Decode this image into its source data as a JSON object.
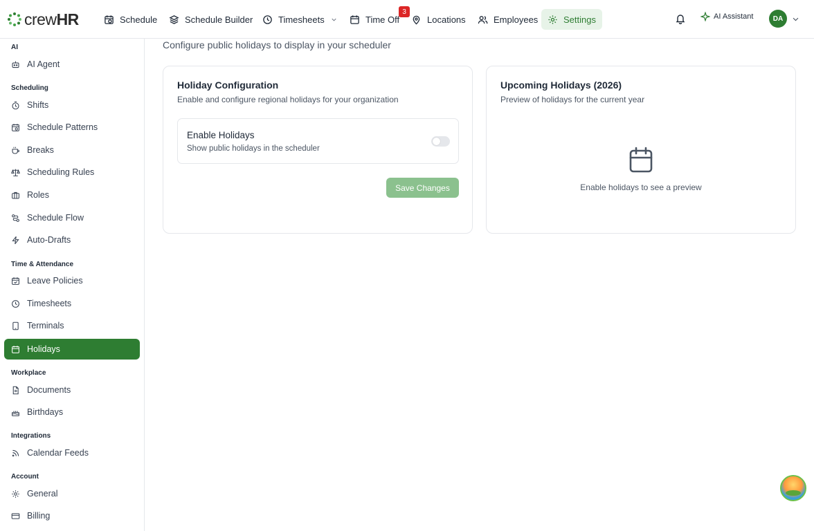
{
  "header": {
    "logo": {
      "prefix": "crew",
      "suffix": "HR"
    },
    "nav": [
      {
        "label": "Schedule",
        "icon": "calendar-clock-icon"
      },
      {
        "label": "Schedule Builder",
        "icon": "layers-icon"
      },
      {
        "label": "Timesheets",
        "icon": "clock-icon"
      },
      {
        "label": "Time Off",
        "icon": "calendar-icon",
        "badge": "3"
      },
      {
        "label": "Locations",
        "icon": "map-pin-icon"
      },
      {
        "label": "Employees",
        "icon": "users-icon"
      },
      {
        "label": "Settings",
        "icon": "gear-icon"
      }
    ],
    "ai_assistant_label": "AI Assistant",
    "avatar_initials": "DA",
    "accent_color": "#2e7d32"
  },
  "sidebar": {
    "sections": [
      {
        "title": "AI",
        "items": [
          "AI Agent"
        ]
      },
      {
        "title": "Scheduling",
        "items": [
          "Shifts",
          "Schedule Patterns",
          "Breaks",
          "Scheduling Rules",
          "Roles",
          "Schedule Flow",
          "Auto-Drafts"
        ]
      },
      {
        "title": "Time & Attendance",
        "items": [
          "Leave Policies",
          "Timesheets",
          "Terminals",
          "Holidays"
        ]
      },
      {
        "title": "Workplace",
        "items": [
          "Documents",
          "Birthdays"
        ]
      },
      {
        "title": "Integrations",
        "items": [
          "Calendar Feeds"
        ]
      },
      {
        "title": "Account",
        "items": [
          "General",
          "Billing"
        ]
      }
    ],
    "active_item": "Holidays"
  },
  "main": {
    "subtitle": "Configure public holidays to display in your scheduler",
    "config_card": {
      "title": "Holiday Configuration",
      "subtitle": "Enable and configure regional holidays for your organization",
      "toggle_title": "Enable Holidays",
      "toggle_subtitle": "Show public holidays in the scheduler",
      "toggle_on": false,
      "save_label": "Save Changes"
    },
    "preview_card": {
      "title": "Upcoming Holidays (2026)",
      "subtitle": "Preview of holidays for the current year",
      "empty_text": "Enable holidays to see a preview",
      "icon": "calendar-icon"
    }
  }
}
